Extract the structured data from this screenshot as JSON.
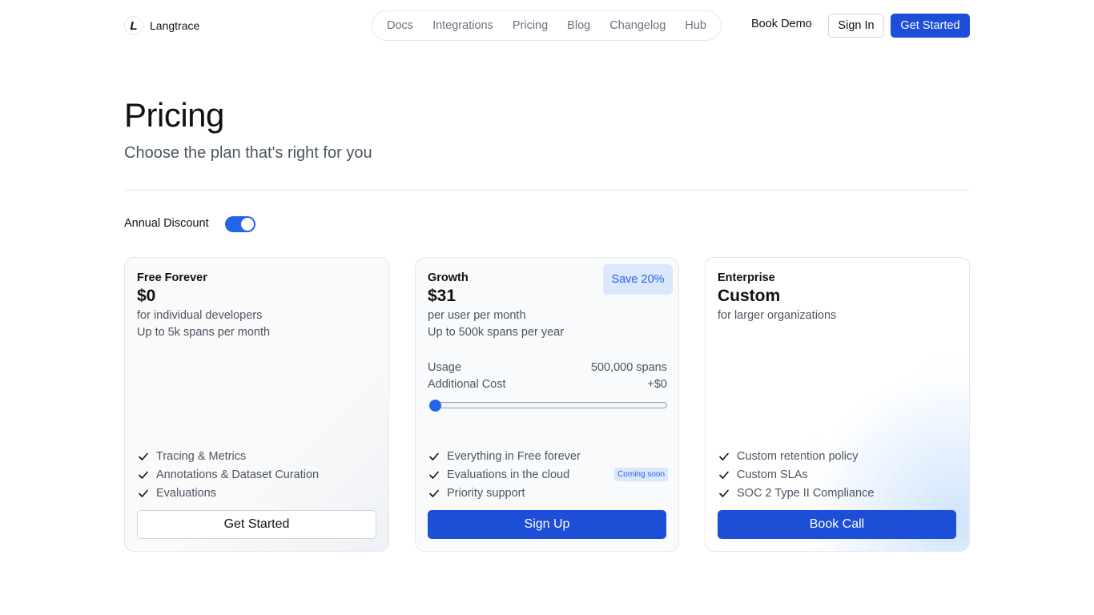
{
  "header": {
    "brand_mark": "L",
    "brand_name": "Langtrace",
    "nav": [
      "Docs",
      "Integrations",
      "Pricing",
      "Blog",
      "Changelog",
      "Hub"
    ],
    "book_demo": "Book Demo",
    "sign_in": "Sign In",
    "get_started": "Get Started"
  },
  "hero": {
    "title": "Pricing",
    "subtitle": "Choose the plan that's right for you"
  },
  "discount": {
    "label": "Annual Discount",
    "enabled": true
  },
  "plans": {
    "free": {
      "name": "Free Forever",
      "price": "$0",
      "desc": "for individual developers",
      "desc2": "Up to 5k spans per month",
      "features": [
        "Tracing & Metrics",
        "Annotations & Dataset Curation",
        "Evaluations"
      ],
      "cta": "Get Started"
    },
    "growth": {
      "name": "Growth",
      "price": "$31",
      "badge": "Save 20%",
      "desc": "per user per month",
      "desc2": "Up to 500k spans per year",
      "usage_label": "Usage",
      "usage_value": "500,000 spans",
      "cost_label": "Additional Cost",
      "cost_value": "+$0",
      "slider_value": 0,
      "features": [
        "Everything in Free forever",
        "Evaluations in the cloud",
        "Priority support"
      ],
      "coming_soon": "Coming soon",
      "cta": "Sign Up"
    },
    "enterprise": {
      "name": "Enterprise",
      "price": "Custom",
      "desc": "for larger organizations",
      "features": [
        "Custom retention policy",
        "Custom SLAs",
        "SOC 2 Type II Compliance"
      ],
      "cta": "Book Call"
    }
  },
  "colors": {
    "accent": "#1d4ed8",
    "badge_bg": "#dbe7fb"
  }
}
